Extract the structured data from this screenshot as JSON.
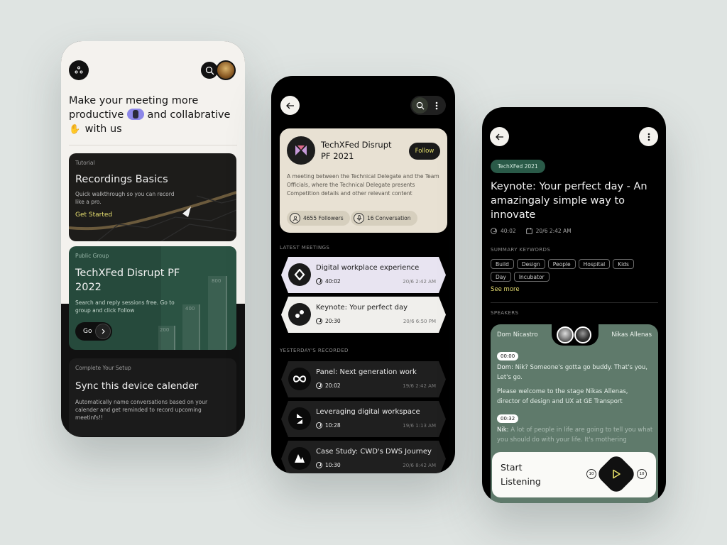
{
  "phone1": {
    "headline_1": "Make your meeting more",
    "headline_2a": "productive",
    "headline_2b": "and collabrative",
    "headline_3": "with us",
    "tutorial": {
      "label": "Tutorial",
      "title": "Recordings Basics",
      "desc": "Quick walkthrough so you can record like a pro.",
      "cta": "Get Started"
    },
    "group": {
      "label": "Public Group",
      "title": "TechXFed Disrupt PF 2022",
      "desc": "Search and reply sessions free. Go to group and click Follow",
      "cta": "Go",
      "bars": [
        "200",
        "400",
        "800"
      ]
    },
    "setup": {
      "label": "Complete Your Setup",
      "title": "Sync this device calender",
      "desc": "Automatically name conversations based on your calender and get reminded to record upcoming meetinfs!!"
    }
  },
  "phone2": {
    "hero": {
      "title": "TechXFed Disrupt PF 2021",
      "follow": "Follow",
      "desc": "A meeting between the Technical Delegate and the Team Officials, where the Technical Delegate presents Competition details and other relevant content",
      "followers": "4655 Followers",
      "conversation": "16 Conversation"
    },
    "latest_label": "LATEST MEETINGS",
    "latest": [
      {
        "title": "Digital workplace experience",
        "duration": "40:02",
        "date": "20/6 2:42 AM"
      },
      {
        "title": "Keynote: Your perfect day",
        "duration": "20:30",
        "date": "20/6 6:50 PM"
      }
    ],
    "yesterday_label": "YESTERDAY'S RECORDED",
    "yesterday": [
      {
        "title": "Panel: Next generation work",
        "duration": "20:02",
        "date": "19/6 2:42 AM"
      },
      {
        "title": "Leveraging digital workspace",
        "duration": "10:28",
        "date": "19/6 1:13 AM"
      },
      {
        "title": "Case Study: CWD's DWS Journey",
        "duration": "10:30",
        "date": "20/6 8:42 AM"
      }
    ]
  },
  "phone3": {
    "tag": "TechXFed 2021",
    "title": "Keynote: Your perfect day - An amazingaly simple way to innovate",
    "duration": "40:02",
    "date": "20/6 2:42 AM",
    "keywords_label": "SUMMARY KEYWORDS",
    "keywords": [
      "Build",
      "Design",
      "People",
      "Hospital",
      "Kids",
      "Day",
      "Incubator"
    ],
    "see_more": "See more",
    "speakers_label": "SPEAKERS",
    "speaker_left": "Dom Nicastro",
    "speaker_right": "Nikas Allenas",
    "transcript": [
      {
        "time": "00:00",
        "speaker": "Dom:",
        "line1": "Nik? Someone's gotta go buddy. That's you, Let's go.",
        "line2": "Please welcome to the stage Nikas Allenas, director of design and UX at GE Transport"
      },
      {
        "time": "00:32",
        "speaker": "Nik:",
        "line1": "A lot of people in life are going to tell you what you should do with your life. It's mothering"
      }
    ],
    "player": {
      "label_1": "Start",
      "label_2": "Listening",
      "rewind": "10",
      "forward": "10"
    }
  },
  "colors": {
    "accent_yellow": "#e8e070",
    "group_green": "#264a3c",
    "speaker_green": "#5f7a6b",
    "hero_beige": "#e8e1d3"
  }
}
